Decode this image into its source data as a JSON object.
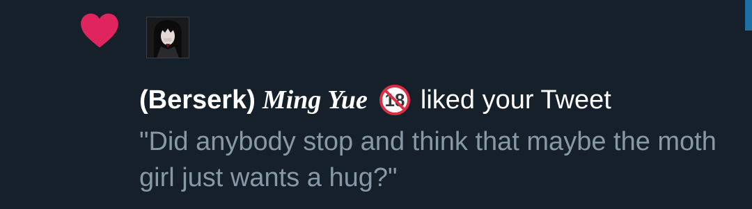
{
  "notification": {
    "type_icon": "heart-icon",
    "heart_color": "#e0245e",
    "avatar": "user-avatar-image",
    "user_name_plain": "(Berserk)",
    "user_name_styled": "Ming Yue",
    "badge_icon": "no-under-18-icon",
    "badge_text": "18",
    "action_text": "liked your Tweet",
    "tweet_text": "\"Did anybody stop and think that maybe the moth girl just wants a hug?\""
  },
  "colors": {
    "background": "#15202b",
    "primary_text": "#ffffff",
    "secondary_text": "#8899a6",
    "accent": "#1d6fa5"
  }
}
